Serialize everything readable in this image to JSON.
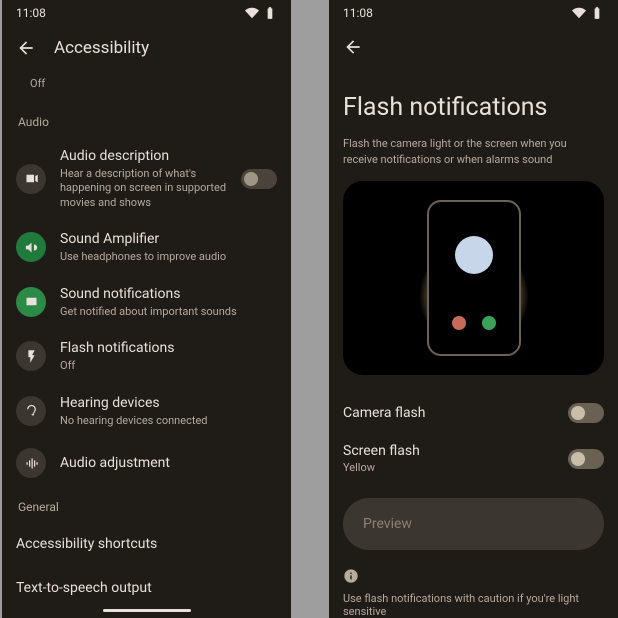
{
  "status": {
    "time": "11:08",
    "wifi_icon": "wifi",
    "battery_icon": "battery"
  },
  "left": {
    "appbar_title": "Accessibility",
    "partial_subtitle": "Off",
    "section_audio": "Audio",
    "rows": [
      {
        "title": "Audio description",
        "subtitle": "Hear a description of what's happening on screen in supported movies and shows",
        "has_toggle": true,
        "icon": "audio-desc"
      },
      {
        "title": "Sound Amplifier",
        "subtitle": "Use headphones to improve audio",
        "icon": "sound-amp"
      },
      {
        "title": "Sound notifications",
        "subtitle": "Get notified about important sounds",
        "icon": "sound-notif"
      },
      {
        "title": "Flash notifications",
        "subtitle": "Off",
        "icon": "flash"
      },
      {
        "title": "Hearing devices",
        "subtitle": "No hearing devices connected",
        "icon": "hearing"
      },
      {
        "title": "Audio adjustment",
        "subtitle": "",
        "icon": "audio-adj"
      }
    ],
    "section_general": "General",
    "general_rows": [
      "Accessibility shortcuts",
      "Text-to-speech output"
    ]
  },
  "right": {
    "title": "Flash notifications",
    "description": "Flash the camera light or the screen when you receive notifications or when alarms sound",
    "camera_flash_label": "Camera flash",
    "screen_flash_label": "Screen flash",
    "screen_flash_value": "Yellow",
    "preview_label": "Preview",
    "caution": "Use flash notifications with caution if you're light sensitive"
  }
}
